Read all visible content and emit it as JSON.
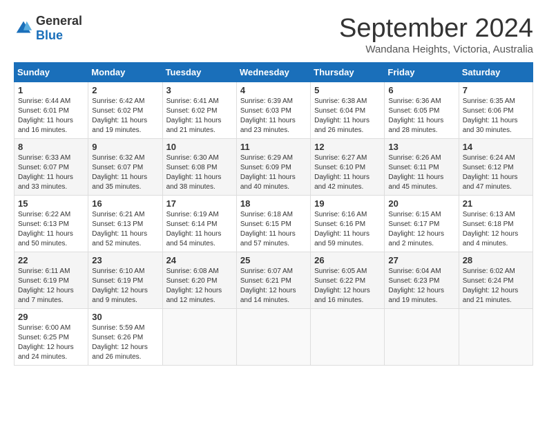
{
  "header": {
    "logo_general": "General",
    "logo_blue": "Blue",
    "month_title": "September 2024",
    "subtitle": "Wandana Heights, Victoria, Australia"
  },
  "calendar": {
    "days_of_week": [
      "Sunday",
      "Monday",
      "Tuesday",
      "Wednesday",
      "Thursday",
      "Friday",
      "Saturday"
    ],
    "weeks": [
      [
        {
          "day": "1",
          "sunrise": "6:44 AM",
          "sunset": "6:01 PM",
          "daylight": "11 hours and 16 minutes."
        },
        {
          "day": "2",
          "sunrise": "6:42 AM",
          "sunset": "6:02 PM",
          "daylight": "11 hours and 19 minutes."
        },
        {
          "day": "3",
          "sunrise": "6:41 AM",
          "sunset": "6:02 PM",
          "daylight": "11 hours and 21 minutes."
        },
        {
          "day": "4",
          "sunrise": "6:39 AM",
          "sunset": "6:03 PM",
          "daylight": "11 hours and 23 minutes."
        },
        {
          "day": "5",
          "sunrise": "6:38 AM",
          "sunset": "6:04 PM",
          "daylight": "11 hours and 26 minutes."
        },
        {
          "day": "6",
          "sunrise": "6:36 AM",
          "sunset": "6:05 PM",
          "daylight": "11 hours and 28 minutes."
        },
        {
          "day": "7",
          "sunrise": "6:35 AM",
          "sunset": "6:06 PM",
          "daylight": "11 hours and 30 minutes."
        }
      ],
      [
        {
          "day": "8",
          "sunrise": "6:33 AM",
          "sunset": "6:07 PM",
          "daylight": "11 hours and 33 minutes."
        },
        {
          "day": "9",
          "sunrise": "6:32 AM",
          "sunset": "6:07 PM",
          "daylight": "11 hours and 35 minutes."
        },
        {
          "day": "10",
          "sunrise": "6:30 AM",
          "sunset": "6:08 PM",
          "daylight": "11 hours and 38 minutes."
        },
        {
          "day": "11",
          "sunrise": "6:29 AM",
          "sunset": "6:09 PM",
          "daylight": "11 hours and 40 minutes."
        },
        {
          "day": "12",
          "sunrise": "6:27 AM",
          "sunset": "6:10 PM",
          "daylight": "11 hours and 42 minutes."
        },
        {
          "day": "13",
          "sunrise": "6:26 AM",
          "sunset": "6:11 PM",
          "daylight": "11 hours and 45 minutes."
        },
        {
          "day": "14",
          "sunrise": "6:24 AM",
          "sunset": "6:12 PM",
          "daylight": "11 hours and 47 minutes."
        }
      ],
      [
        {
          "day": "15",
          "sunrise": "6:22 AM",
          "sunset": "6:13 PM",
          "daylight": "11 hours and 50 minutes."
        },
        {
          "day": "16",
          "sunrise": "6:21 AM",
          "sunset": "6:13 PM",
          "daylight": "11 hours and 52 minutes."
        },
        {
          "day": "17",
          "sunrise": "6:19 AM",
          "sunset": "6:14 PM",
          "daylight": "11 hours and 54 minutes."
        },
        {
          "day": "18",
          "sunrise": "6:18 AM",
          "sunset": "6:15 PM",
          "daylight": "11 hours and 57 minutes."
        },
        {
          "day": "19",
          "sunrise": "6:16 AM",
          "sunset": "6:16 PM",
          "daylight": "11 hours and 59 minutes."
        },
        {
          "day": "20",
          "sunrise": "6:15 AM",
          "sunset": "6:17 PM",
          "daylight": "12 hours and 2 minutes."
        },
        {
          "day": "21",
          "sunrise": "6:13 AM",
          "sunset": "6:18 PM",
          "daylight": "12 hours and 4 minutes."
        }
      ],
      [
        {
          "day": "22",
          "sunrise": "6:11 AM",
          "sunset": "6:19 PM",
          "daylight": "12 hours and 7 minutes."
        },
        {
          "day": "23",
          "sunrise": "6:10 AM",
          "sunset": "6:19 PM",
          "daylight": "12 hours and 9 minutes."
        },
        {
          "day": "24",
          "sunrise": "6:08 AM",
          "sunset": "6:20 PM",
          "daylight": "12 hours and 12 minutes."
        },
        {
          "day": "25",
          "sunrise": "6:07 AM",
          "sunset": "6:21 PM",
          "daylight": "12 hours and 14 minutes."
        },
        {
          "day": "26",
          "sunrise": "6:05 AM",
          "sunset": "6:22 PM",
          "daylight": "12 hours and 16 minutes."
        },
        {
          "day": "27",
          "sunrise": "6:04 AM",
          "sunset": "6:23 PM",
          "daylight": "12 hours and 19 minutes."
        },
        {
          "day": "28",
          "sunrise": "6:02 AM",
          "sunset": "6:24 PM",
          "daylight": "12 hours and 21 minutes."
        }
      ],
      [
        {
          "day": "29",
          "sunrise": "6:00 AM",
          "sunset": "6:25 PM",
          "daylight": "12 hours and 24 minutes."
        },
        {
          "day": "30",
          "sunrise": "5:59 AM",
          "sunset": "6:26 PM",
          "daylight": "12 hours and 26 minutes."
        },
        null,
        null,
        null,
        null,
        null
      ]
    ],
    "labels": {
      "sunrise": "Sunrise: ",
      "sunset": "Sunset: ",
      "daylight": "Daylight: "
    }
  }
}
